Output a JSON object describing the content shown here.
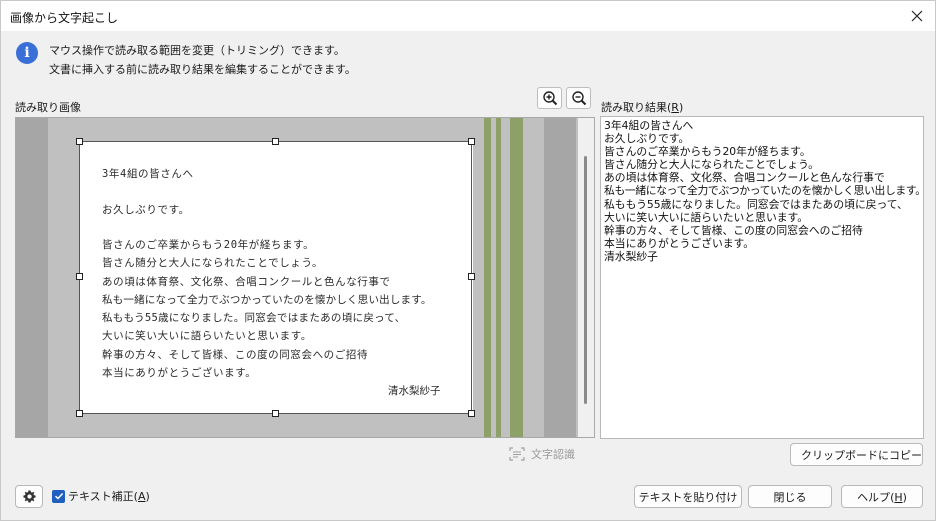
{
  "window": {
    "title": "画像から文字起こし",
    "close_icon": "close-icon"
  },
  "info": {
    "icon": "info-icon",
    "line1": "マウス操作で読み取る範囲を変更（トリミング）できます。",
    "line2": "文書に挿入する前に読み取り結果を編集することができます。"
  },
  "image_section": {
    "label": "読み取り画像",
    "zoom_in_icon": "zoom-in-icon",
    "zoom_out_icon": "zoom-out-icon",
    "handwritten_lines": [
      "3年4組の皆さんへ",
      "お久しぶりです。",
      "皆さんのご卒業からもう20年が経ちます。",
      "皆さん随分と大人になられたことでしょう。",
      "あの頃は体育祭、文化祭、合唱コンクールと色んな行事で",
      "私も一緒になって全力でぶつかっていたのを懐かしく思い出します。",
      "私ももう55歳になりました。同窓会ではまたあの頃に戻って、",
      "大いに笑い大いに語らいたいと思います。",
      "幹事の方々、そして皆様、この度の同窓会へのご招待",
      "本当にありがとうございます。"
    ],
    "signature": "清水梨紗子",
    "ocr_button": "文字認識"
  },
  "result_section": {
    "label": "読み取り結果",
    "label_mnemonic": "R",
    "lines": [
      "3年4組の皆さんへ",
      "お久しぶりです。",
      "皆さんのご卒業からもう20年が経ちます。",
      "皆さん随分と大人になられたことでしょう。",
      "あの頃は体育祭、文化祭、合唱コンクールと色んな行事で",
      "私も一緒になって全力でぶつかっていたのを懐かしく思い出します。",
      "私ももう55歳になりました。同窓会ではまたあの頃に戻って、",
      "大いに笑い大いに語らいたいと思います。",
      "幹事の方々、そして皆様、この度の同窓会へのご招待",
      "本当にありがとうございます。",
      "清水梨紗子"
    ],
    "copy_button": "クリップボードにコピー"
  },
  "footer": {
    "settings_icon": "gear-icon",
    "checkbox_label": "テキスト補正",
    "checkbox_mnemonic": "A",
    "checkbox_checked": true,
    "paste_button": "テキストを貼り付け",
    "close_button": "閉じる",
    "help_button": "ヘルプ",
    "help_mnemonic": "H"
  },
  "colors": {
    "accent": "#1f5fbf",
    "info": "#3a6fd8",
    "stripe": "#8da067"
  }
}
